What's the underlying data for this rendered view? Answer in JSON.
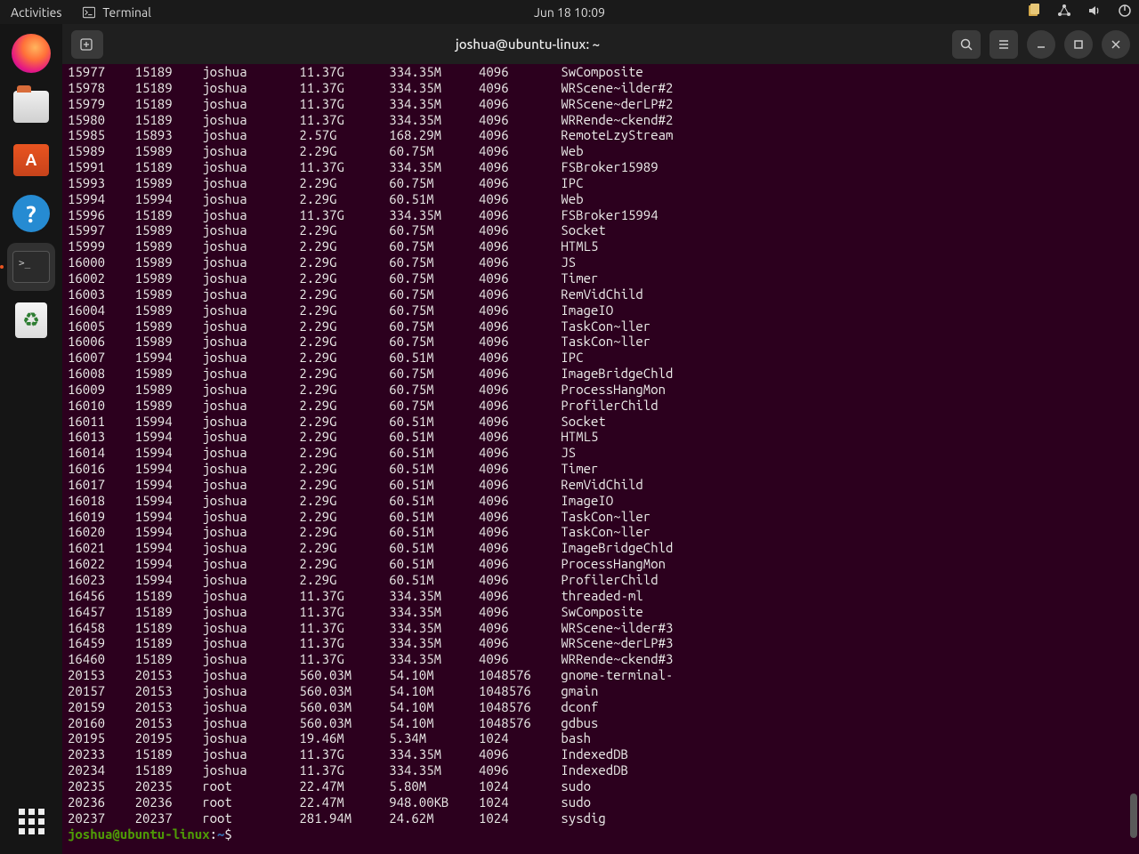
{
  "topbar": {
    "activities": "Activities",
    "app_label": "Terminal",
    "clock": "Jun 18  10:09"
  },
  "window": {
    "title": "joshua@ubuntu-linux: ~"
  },
  "prompt": {
    "userhost": "joshua@ubuntu-linux",
    "sep": ":",
    "path": "~",
    "dollar": "$ "
  },
  "rows": [
    {
      "c1": "15977",
      "c2": "15189",
      "c3": "joshua",
      "c4": "11.37G",
      "c5": "334.35M",
      "c6": "4096",
      "c7": "SwComposite"
    },
    {
      "c1": "15978",
      "c2": "15189",
      "c3": "joshua",
      "c4": "11.37G",
      "c5": "334.35M",
      "c6": "4096",
      "c7": "WRScene~ilder#2"
    },
    {
      "c1": "15979",
      "c2": "15189",
      "c3": "joshua",
      "c4": "11.37G",
      "c5": "334.35M",
      "c6": "4096",
      "c7": "WRScene~derLP#2"
    },
    {
      "c1": "15980",
      "c2": "15189",
      "c3": "joshua",
      "c4": "11.37G",
      "c5": "334.35M",
      "c6": "4096",
      "c7": "WRRende~ckend#2"
    },
    {
      "c1": "15985",
      "c2": "15893",
      "c3": "joshua",
      "c4": "2.57G",
      "c5": "168.29M",
      "c6": "4096",
      "c7": "RemoteLzyStream"
    },
    {
      "c1": "15989",
      "c2": "15989",
      "c3": "joshua",
      "c4": "2.29G",
      "c5": "60.75M",
      "c6": "4096",
      "c7": "Web"
    },
    {
      "c1": "15991",
      "c2": "15189",
      "c3": "joshua",
      "c4": "11.37G",
      "c5": "334.35M",
      "c6": "4096",
      "c7": "FSBroker15989"
    },
    {
      "c1": "15993",
      "c2": "15989",
      "c3": "joshua",
      "c4": "2.29G",
      "c5": "60.75M",
      "c6": "4096",
      "c7": "IPC"
    },
    {
      "c1": "15994",
      "c2": "15994",
      "c3": "joshua",
      "c4": "2.29G",
      "c5": "60.51M",
      "c6": "4096",
      "c7": "Web"
    },
    {
      "c1": "15996",
      "c2": "15189",
      "c3": "joshua",
      "c4": "11.37G",
      "c5": "334.35M",
      "c6": "4096",
      "c7": "FSBroker15994"
    },
    {
      "c1": "15997",
      "c2": "15989",
      "c3": "joshua",
      "c4": "2.29G",
      "c5": "60.75M",
      "c6": "4096",
      "c7": "Socket"
    },
    {
      "c1": "15999",
      "c2": "15989",
      "c3": "joshua",
      "c4": "2.29G",
      "c5": "60.75M",
      "c6": "4096",
      "c7": "HTML5"
    },
    {
      "c1": "16000",
      "c2": "15989",
      "c3": "joshua",
      "c4": "2.29G",
      "c5": "60.75M",
      "c6": "4096",
      "c7": "JS"
    },
    {
      "c1": "16002",
      "c2": "15989",
      "c3": "joshua",
      "c4": "2.29G",
      "c5": "60.75M",
      "c6": "4096",
      "c7": "Timer"
    },
    {
      "c1": "16003",
      "c2": "15989",
      "c3": "joshua",
      "c4": "2.29G",
      "c5": "60.75M",
      "c6": "4096",
      "c7": "RemVidChild"
    },
    {
      "c1": "16004",
      "c2": "15989",
      "c3": "joshua",
      "c4": "2.29G",
      "c5": "60.75M",
      "c6": "4096",
      "c7": "ImageIO"
    },
    {
      "c1": "16005",
      "c2": "15989",
      "c3": "joshua",
      "c4": "2.29G",
      "c5": "60.75M",
      "c6": "4096",
      "c7": "TaskCon~ller"
    },
    {
      "c1": "16006",
      "c2": "15989",
      "c3": "joshua",
      "c4": "2.29G",
      "c5": "60.75M",
      "c6": "4096",
      "c7": "TaskCon~ller"
    },
    {
      "c1": "16007",
      "c2": "15994",
      "c3": "joshua",
      "c4": "2.29G",
      "c5": "60.51M",
      "c6": "4096",
      "c7": "IPC"
    },
    {
      "c1": "16008",
      "c2": "15989",
      "c3": "joshua",
      "c4": "2.29G",
      "c5": "60.75M",
      "c6": "4096",
      "c7": "ImageBridgeChld"
    },
    {
      "c1": "16009",
      "c2": "15989",
      "c3": "joshua",
      "c4": "2.29G",
      "c5": "60.75M",
      "c6": "4096",
      "c7": "ProcessHangMon"
    },
    {
      "c1": "16010",
      "c2": "15989",
      "c3": "joshua",
      "c4": "2.29G",
      "c5": "60.75M",
      "c6": "4096",
      "c7": "ProfilerChild"
    },
    {
      "c1": "16011",
      "c2": "15994",
      "c3": "joshua",
      "c4": "2.29G",
      "c5": "60.51M",
      "c6": "4096",
      "c7": "Socket"
    },
    {
      "c1": "16013",
      "c2": "15994",
      "c3": "joshua",
      "c4": "2.29G",
      "c5": "60.51M",
      "c6": "4096",
      "c7": "HTML5"
    },
    {
      "c1": "16014",
      "c2": "15994",
      "c3": "joshua",
      "c4": "2.29G",
      "c5": "60.51M",
      "c6": "4096",
      "c7": "JS"
    },
    {
      "c1": "16016",
      "c2": "15994",
      "c3": "joshua",
      "c4": "2.29G",
      "c5": "60.51M",
      "c6": "4096",
      "c7": "Timer"
    },
    {
      "c1": "16017",
      "c2": "15994",
      "c3": "joshua",
      "c4": "2.29G",
      "c5": "60.51M",
      "c6": "4096",
      "c7": "RemVidChild"
    },
    {
      "c1": "16018",
      "c2": "15994",
      "c3": "joshua",
      "c4": "2.29G",
      "c5": "60.51M",
      "c6": "4096",
      "c7": "ImageIO"
    },
    {
      "c1": "16019",
      "c2": "15994",
      "c3": "joshua",
      "c4": "2.29G",
      "c5": "60.51M",
      "c6": "4096",
      "c7": "TaskCon~ller"
    },
    {
      "c1": "16020",
      "c2": "15994",
      "c3": "joshua",
      "c4": "2.29G",
      "c5": "60.51M",
      "c6": "4096",
      "c7": "TaskCon~ller"
    },
    {
      "c1": "16021",
      "c2": "15994",
      "c3": "joshua",
      "c4": "2.29G",
      "c5": "60.51M",
      "c6": "4096",
      "c7": "ImageBridgeChld"
    },
    {
      "c1": "16022",
      "c2": "15994",
      "c3": "joshua",
      "c4": "2.29G",
      "c5": "60.51M",
      "c6": "4096",
      "c7": "ProcessHangMon"
    },
    {
      "c1": "16023",
      "c2": "15994",
      "c3": "joshua",
      "c4": "2.29G",
      "c5": "60.51M",
      "c6": "4096",
      "c7": "ProfilerChild"
    },
    {
      "c1": "16456",
      "c2": "15189",
      "c3": "joshua",
      "c4": "11.37G",
      "c5": "334.35M",
      "c6": "4096",
      "c7": "threaded-ml"
    },
    {
      "c1": "16457",
      "c2": "15189",
      "c3": "joshua",
      "c4": "11.37G",
      "c5": "334.35M",
      "c6": "4096",
      "c7": "SwComposite"
    },
    {
      "c1": "16458",
      "c2": "15189",
      "c3": "joshua",
      "c4": "11.37G",
      "c5": "334.35M",
      "c6": "4096",
      "c7": "WRScene~ilder#3"
    },
    {
      "c1": "16459",
      "c2": "15189",
      "c3": "joshua",
      "c4": "11.37G",
      "c5": "334.35M",
      "c6": "4096",
      "c7": "WRScene~derLP#3"
    },
    {
      "c1": "16460",
      "c2": "15189",
      "c3": "joshua",
      "c4": "11.37G",
      "c5": "334.35M",
      "c6": "4096",
      "c7": "WRRende~ckend#3"
    },
    {
      "c1": "20153",
      "c2": "20153",
      "c3": "joshua",
      "c4": "560.03M",
      "c5": "54.10M",
      "c6": "1048576",
      "c7": "gnome-terminal-"
    },
    {
      "c1": "20157",
      "c2": "20153",
      "c3": "joshua",
      "c4": "560.03M",
      "c5": "54.10M",
      "c6": "1048576",
      "c7": "gmain"
    },
    {
      "c1": "20159",
      "c2": "20153",
      "c3": "joshua",
      "c4": "560.03M",
      "c5": "54.10M",
      "c6": "1048576",
      "c7": "dconf"
    },
    {
      "c1": "20160",
      "c2": "20153",
      "c3": "joshua",
      "c4": "560.03M",
      "c5": "54.10M",
      "c6": "1048576",
      "c7": "gdbus"
    },
    {
      "c1": "20195",
      "c2": "20195",
      "c3": "joshua",
      "c4": "19.46M",
      "c5": "5.34M",
      "c6": "1024",
      "c7": "bash"
    },
    {
      "c1": "20233",
      "c2": "15189",
      "c3": "joshua",
      "c4": "11.37G",
      "c5": "334.35M",
      "c6": "4096",
      "c7": "IndexedDB"
    },
    {
      "c1": "20234",
      "c2": "15189",
      "c3": "joshua",
      "c4": "11.37G",
      "c5": "334.35M",
      "c6": "4096",
      "c7": "IndexedDB"
    },
    {
      "c1": "20235",
      "c2": "20235",
      "c3": "root",
      "c4": "22.47M",
      "c5": "5.80M",
      "c6": "1024",
      "c7": "sudo"
    },
    {
      "c1": "20236",
      "c2": "20236",
      "c3": "root",
      "c4": "22.47M",
      "c5": "948.00KB",
      "c6": "1024",
      "c7": "sudo"
    },
    {
      "c1": "20237",
      "c2": "20237",
      "c3": "root",
      "c4": "281.94M",
      "c5": "24.62M",
      "c6": "1024",
      "c7": "sysdig"
    }
  ]
}
